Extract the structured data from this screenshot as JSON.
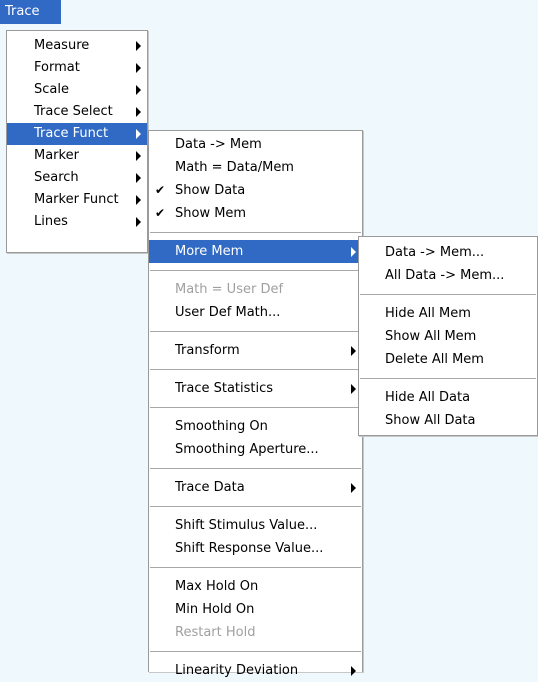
{
  "menubar": {
    "title": "Trace"
  },
  "trace_menu": {
    "items": [
      "Measure",
      "Format",
      "Scale",
      "Trace Select",
      "Trace Funct",
      "Marker",
      "Search",
      "Marker Funct",
      "Lines"
    ]
  },
  "trace_funct_menu": {
    "data_to_mem": "Data -> Mem",
    "math_data_mem": "Math = Data/Mem",
    "show_data": "Show Data",
    "show_mem": "Show Mem",
    "more_mem": "More Mem",
    "math_user_def": "Math = User Def",
    "user_def_math": "User Def Math...",
    "transform": "Transform",
    "trace_statistics": "Trace Statistics",
    "smoothing_on": "Smoothing On",
    "smoothing_aperture": "Smoothing Aperture...",
    "trace_data": "Trace Data",
    "shift_stimulus": "Shift Stimulus Value...",
    "shift_response": "Shift Response Value...",
    "max_hold_on": "Max Hold On",
    "min_hold_on": "Min Hold On",
    "restart_hold": "Restart Hold",
    "linearity_deviation": "Linearity Deviation",
    "checkmark": "✔"
  },
  "more_mem_menu": {
    "data_to_mem": "Data -> Mem...",
    "all_data_to_mem": "All Data -> Mem...",
    "hide_all_mem": "Hide All Mem",
    "show_all_mem": "Show All Mem",
    "delete_all_mem": "Delete All Mem",
    "hide_all_data": "Hide All Data",
    "show_all_data": "Show All Data"
  },
  "colors": {
    "highlight": "#316ac5",
    "disabled": "#a0a0a0",
    "background": "#eef8fd"
  }
}
